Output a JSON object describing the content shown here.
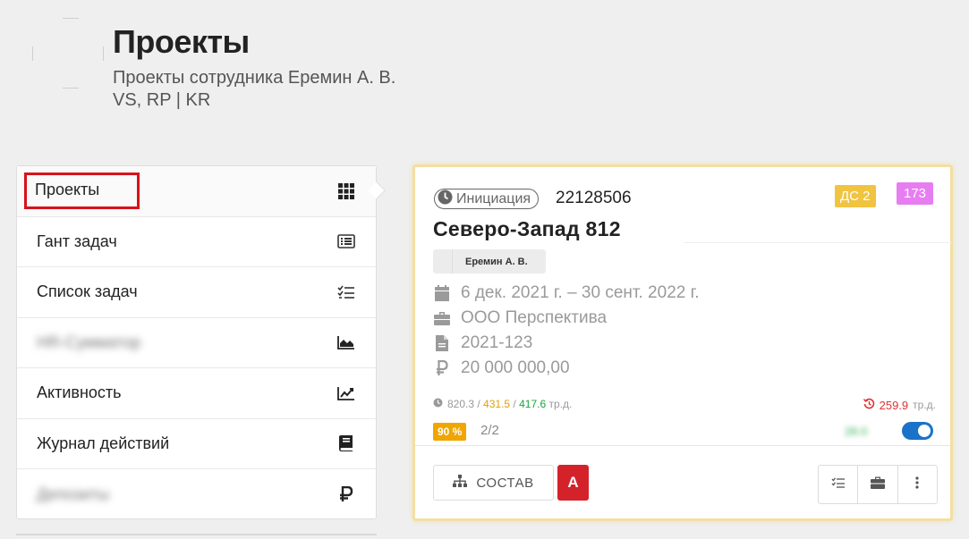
{
  "header": {
    "title": "Проекты",
    "subtitle_line1": "Проекты сотрудника Еремин А. В.",
    "subtitle_line2": "VS, RP | KR"
  },
  "sidebar": {
    "items": [
      {
        "label": "Проекты",
        "icon": "grid-icon",
        "active": true
      },
      {
        "label": "Гант задач",
        "icon": "list-alt-icon"
      },
      {
        "label": "Список задач",
        "icon": "tasks-icon"
      },
      {
        "label": "НR-Сумматор",
        "icon": "area-chart-icon",
        "blurred": true
      },
      {
        "label": "Активность",
        "icon": "line-chart-icon"
      },
      {
        "label": "Журнал действий",
        "icon": "book-icon"
      },
      {
        "label": "Депозиты",
        "icon": "ruble-icon",
        "blurred": true
      }
    ]
  },
  "card": {
    "stage": "Инициация",
    "number": "22128506",
    "ds_badge": "ДС 2",
    "count_badge": "173",
    "name": "Северо-Запад 812",
    "person": "Еремин А. В.",
    "dates": "6 дек. 2021 г. – 30 сент. 2022 г.",
    "company": "ООО Перспектива",
    "contract": "2021-123",
    "amount": "20 000 000,00",
    "hours_total": "820.3",
    "hours_orange": "431.5",
    "hours_green": "417.6",
    "hours_unit": "тр.д.",
    "overdue_value": "259.9",
    "overdue_unit": "тр.д.",
    "percent": "90 %",
    "progress_count": "2/2",
    "blurred_value": "28.0",
    "toggle_on": true,
    "sostav_label": "СОСТАВ",
    "a_label": "А"
  },
  "colors": {
    "accent_red": "#d8121a",
    "ds_yellow": "#f0c441",
    "count_pink": "#e67ef2",
    "percent_orange": "#f0a500",
    "toggle_blue": "#1a73c8"
  }
}
